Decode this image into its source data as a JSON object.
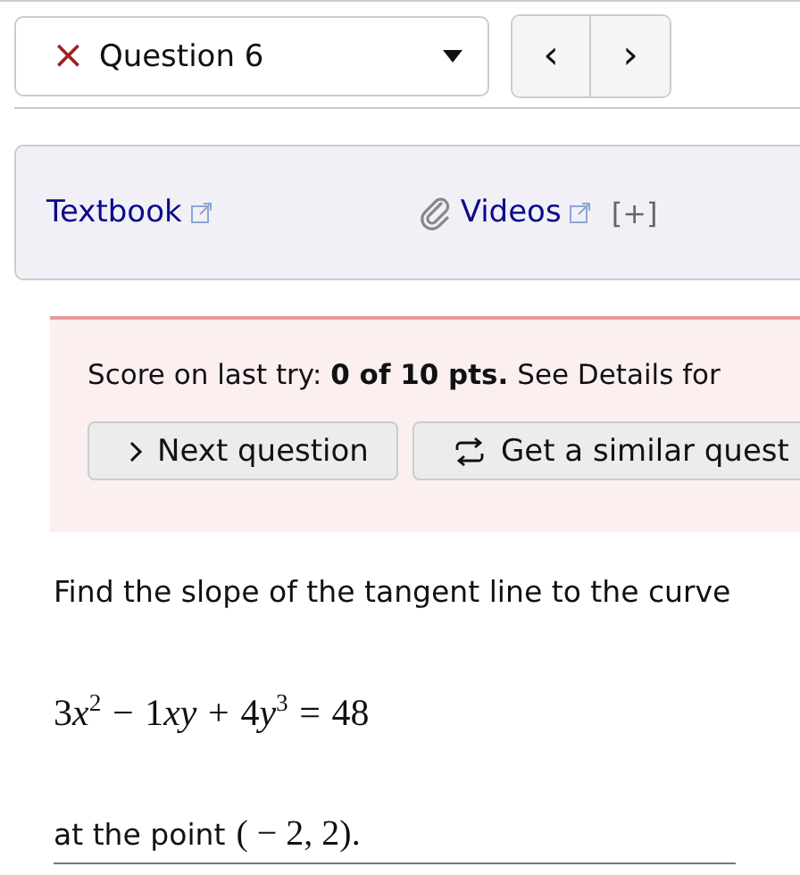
{
  "question_select": {
    "status_icon": "×",
    "label": "Question 6"
  },
  "nav_buttons": [
    {
      "label": "‹",
      "kind": "prev"
    },
    {
      "label": "›",
      "kind": "next"
    }
  ],
  "resources": [
    {
      "label": "Textbook",
      "kind": "textbook"
    },
    {
      "label": "Videos",
      "kind": "videos",
      "extra": "[+]"
    }
  ],
  "alert": {
    "score": "Score on last try: **0 of 10 pts.** See Details for",
    "buttons": [
      {
        "label": "Next question",
        "kind": "next"
      },
      {
        "label": "Get a similar quest",
        "kind": "similar"
      }
    ]
  },
  "question": {
    "prompt": "Find the slope of the tangent line to the curve",
    "equation": [
      {
        "kind": "num",
        "text": "3"
      },
      {
        "kind": "var",
        "text": "x",
        "sup": "2"
      },
      {
        "kind": "op",
        "text": "−"
      },
      {
        "kind": "num",
        "text": "1"
      },
      {
        "kind": "var",
        "text": "xy"
      },
      {
        "kind": "op",
        "text": "+"
      },
      {
        "kind": "num",
        "text": "4"
      },
      {
        "kind": "var",
        "text": "y",
        "sup": "3"
      },
      {
        "kind": "op",
        "text": "="
      },
      {
        "kind": "num",
        "text": "48"
      }
    ],
    "point_label": "at the point",
    "point": "( − 2, 2)."
  }
}
